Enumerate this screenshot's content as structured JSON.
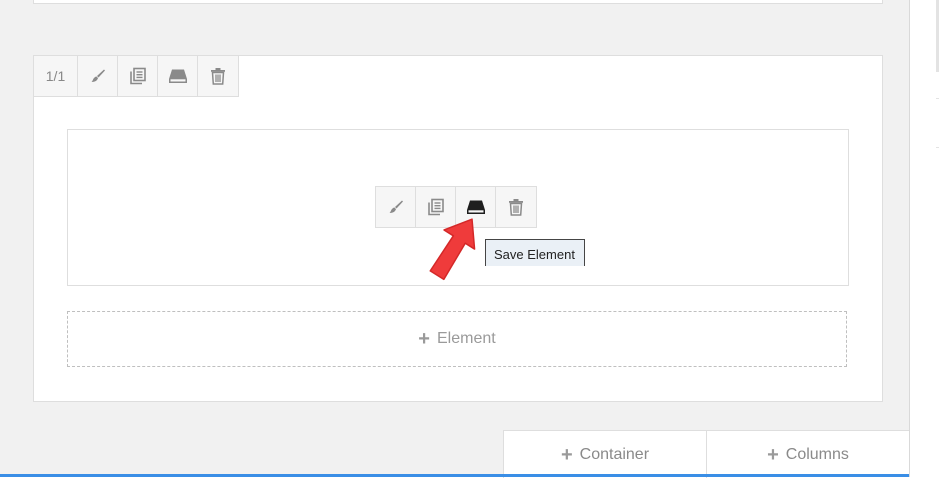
{
  "row": {
    "counter": "1/1",
    "toolbar_icons": [
      "brush-icon",
      "duplicate-icon",
      "save-icon",
      "trash-icon"
    ]
  },
  "element_toolbar": {
    "icons": [
      "brush-icon",
      "duplicate-icon",
      "save-icon",
      "trash-icon"
    ],
    "tooltip": "Save Element"
  },
  "add_element": {
    "plus": "+",
    "label": "Element"
  },
  "bottom_bar": {
    "container_label": "Container",
    "columns_label": "Columns",
    "plus": "+"
  },
  "colors": {
    "annotation_arrow": "#ef3b3b",
    "accent_blue": "#3a8ee6"
  }
}
